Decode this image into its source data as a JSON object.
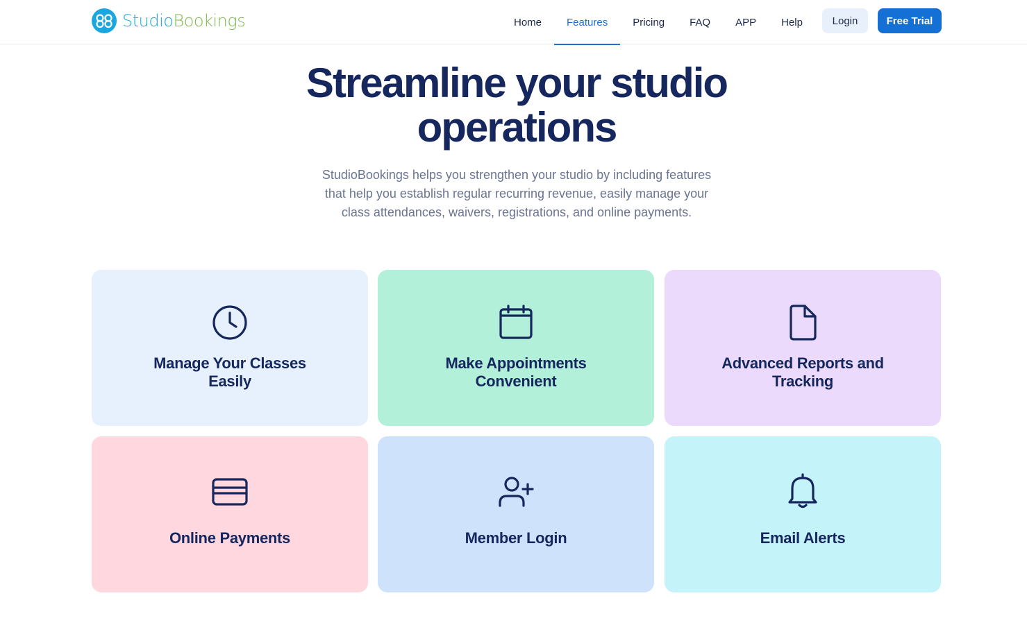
{
  "brand": {
    "name_part1": "Studio",
    "name_part2": "Bookings",
    "colors": {
      "blue": "#1aa6df",
      "green": "#7db94a"
    }
  },
  "nav": {
    "items": [
      {
        "label": "Home"
      },
      {
        "label": "Features",
        "active": true
      },
      {
        "label": "Pricing"
      },
      {
        "label": "FAQ"
      },
      {
        "label": "APP"
      },
      {
        "label": "Help"
      }
    ],
    "login_label": "Login",
    "trial_label": "Free Trial"
  },
  "hero": {
    "title": "Streamline your studio operations",
    "subtitle": "StudioBookings helps you strengthen your studio by including features that help you establish regular recurring revenue, easily manage your class attendances, waivers, registrations, and online payments."
  },
  "features": [
    {
      "label": "Manage Your Classes Easily",
      "icon": "clock-icon",
      "color": "#e6f1fd"
    },
    {
      "label": "Make Appointments Convenient",
      "icon": "calendar-icon",
      "color": "#b2f0d9"
    },
    {
      "label": "Advanced Reports and Tracking",
      "icon": "document-icon",
      "color": "#ecdafd"
    },
    {
      "label": "Online Payments",
      "icon": "credit-card-icon",
      "color": "#fed7df"
    },
    {
      "label": "Member Login",
      "icon": "user-plus-icon",
      "color": "#cfe2fb"
    },
    {
      "label": "Email Alerts",
      "icon": "bell-icon",
      "color": "#c5f3fa"
    }
  ]
}
